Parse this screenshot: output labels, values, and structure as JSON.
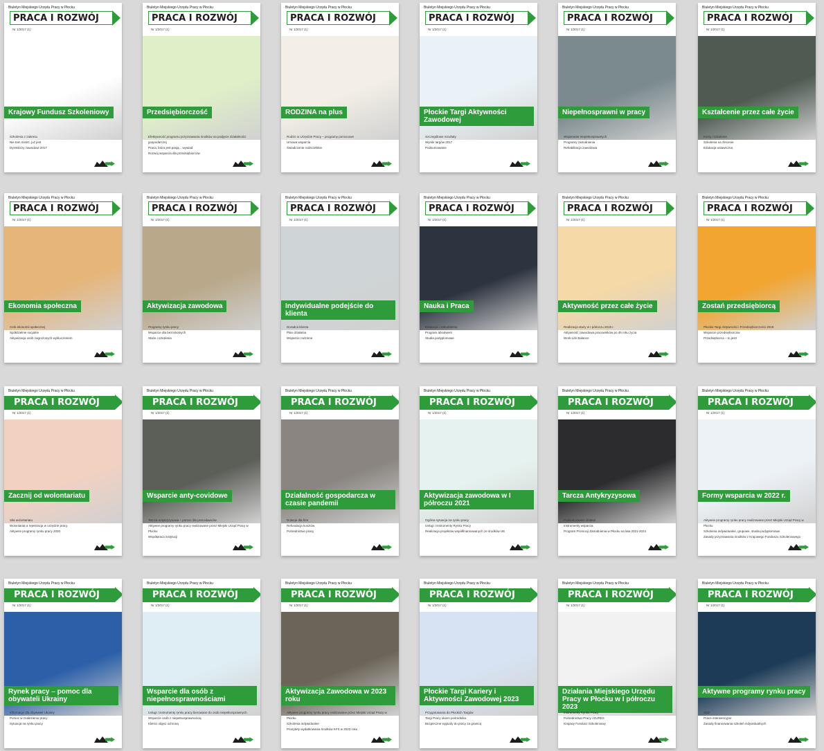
{
  "covers": [
    {
      "title": "Krajowy Fundusz Szkoleniowy",
      "lines": [
        "Szkolenia z zakresu",
        "Nie tam mistrz, już jest",
        "Dyrektorzy zawodowi 2017"
      ],
      "bg": "#ffffff"
    },
    {
      "title": "Przedsiębiorczość",
      "lines": [
        "Efektywność programu przyznawania środków na podjęcie działalności gospodarczej",
        "Praca, która jest pasją... wywiad",
        "Rozwój wsparcia dla przedsiębiorców"
      ],
      "bg": "#dff0c8"
    },
    {
      "title": "RODZINA na plus",
      "lines": [
        "Rodzic w Urzędzie Pracy – programy pomocowe",
        "Umowa wsparcia",
        "Świadczenie rodzicielskie"
      ],
      "bg": "#f3efe6"
    },
    {
      "title": "Płockie Targi Aktywności Zawodowej",
      "lines": [
        "Szczegółowe rezultaty",
        "Wyniki targów 2017",
        "Podsumowanie"
      ],
      "bg": "#eaf2f7"
    },
    {
      "title": "Niepełnosprawni w pracy",
      "lines": [
        "Wspieranie niepełnosprawnych",
        "Programy zatrudnienia",
        "Rehabilitacja zawodowa"
      ],
      "bg": "#7b8a8f"
    },
    {
      "title": "Kształcenie przez całe życie",
      "lines": [
        "Kursy i szkolenia",
        "Szkolenia na zlecenie",
        "Edukacja ustawiczna"
      ],
      "bg": "#4e5a52"
    },
    {
      "title": "Ekonomia społeczna",
      "lines": [
        "Cele ekonomii społecznej",
        "Spółdzielnie socjalne",
        "Aktywizacja osób zagrożonych wykluczeniem"
      ],
      "bg": "#e6b57a"
    },
    {
      "title": "Aktywizacja zawodowa",
      "lines": [
        "Programy rynku pracy",
        "Wsparcie dla bezrobotnych",
        "Staże i szkolenia"
      ],
      "bg": "#b9a88a"
    },
    {
      "title": "Indywidualne podejście do klienta",
      "lines": [
        "Doradca klienta",
        "Plan działania",
        "Wsparcie rodzinne"
      ],
      "bg": "#cfd4d6"
    },
    {
      "title": "Nauka i Praca",
      "lines": [
        "Edukacja i zatrudnienie",
        "Program absolwent",
        "Studia podyplomowe"
      ],
      "bg": "#2d3440"
    },
    {
      "title": "Aktywność przez całe życie",
      "lines": [
        "Realizacja staży w I półroczu 2019 r.",
        "Aktywność zawodowa pracowników po 45 roku życia",
        "Work-Life Balance"
      ],
      "bg": "#f5d9a6"
    },
    {
      "title": "Zostań przedsiębiorcą",
      "lines": [
        "Płockie Targi Aktywności i Przedsiębiorczości 2019",
        "Wsparcie przedsiębiorców",
        "Przedsiębiorca – to jest!"
      ],
      "bg": "#f2a531"
    },
    {
      "title": "Zacznij od wolontariatu",
      "lines": [
        "Siła wolontariatu",
        "Wolontariat a rejestracja w urzędzie pracy",
        "Aktywne programy rynku pracy 2020"
      ],
      "bg": "#f3d1c1"
    },
    {
      "title": "Wsparcie anty-covidowe",
      "lines": [
        "Tarcza Antykryzysowa – pomoc dla pracodawców",
        "Aktywne programy rynku pracy realizowane przez Miejski Urząd Pracy w Płocku",
        "Współpraca instytucji"
      ],
      "bg": "#5c5e58"
    },
    {
      "title": "Działalność gospodarcza w czasie pandemii",
      "lines": [
        "Dotacje dla firm",
        "Refundacja kosztów",
        "Pośrednictwo pracy"
      ],
      "bg": "#8a8580"
    },
    {
      "title": "Aktywizacja zawodowa w I półroczu 2021",
      "lines": [
        "Ogólna sytuacja na rynku pracy",
        "Usługi i instrumenty Rynku Pracy",
        "Realizacja projektów współfinansowanych ze środków UE"
      ],
      "bg": "#e6f2ef"
    },
    {
      "title": "Tarcza Antykryzysowa",
      "lines": [
        "Podsumowanie działań",
        "Instrumenty wsparcia",
        "Program Promocji Zatrudnienia w Płocku na lata 2021-2024"
      ],
      "bg": "#2c2c2e"
    },
    {
      "title": "Formy wsparcia w 2022 r.",
      "lines": [
        "Aktywne programy rynku pracy realizowane przez Miejski Urząd Pracy w Płocku",
        "Szkolenia indywidualne, grupowe, studia podyplomowe",
        "Zasady przyznawania środków z Krajowego Funduszu Szkoleniowego"
      ],
      "bg": "#edf2f7"
    },
    {
      "title": "Rynek pracy – pomoc dla obywateli Ukrainy",
      "lines": [
        "Informacje dla obywateli Ukrainy",
        "Pomoc w znalezieniu pracy",
        "Sytuacja na rynku pracy"
      ],
      "bg": "#2b5fa8"
    },
    {
      "title": "Wsparcie dla osób z niepełnosprawnościami",
      "lines": [
        "Usługi i instrumenty rynku pracy kierowane do osób niepełnosprawnych",
        "Wsparcie osób z niepełnosprawnością",
        "Klienci objęci ochroną"
      ],
      "bg": "#dfeef4"
    },
    {
      "title": "Aktywizacja Zawodowa w 2023 roku",
      "lines": [
        "Aktywne programy rynku pracy realizowane przez Miejski Urząd Pracy w Płocku",
        "Szkolenia indywidualne",
        "Priorytety wydatkowania środków KFS w 2023 roku"
      ],
      "bg": "#6b6458"
    },
    {
      "title": "Płockie Targi Kariery i Aktywności Zawodowej 2023",
      "lines": [
        "Przygotowania do Płockich Targów",
        "Targi Pracy okiem pośrednika",
        "Bezpieczne wyjazdy do pracy za granicą"
      ],
      "bg": "#d7e3f2"
    },
    {
      "title": "Działania Miejskiego Urzędu Pracy w Płocku w I półroczu 2023",
      "lines": [
        "Instrumenty Rynku Pracy",
        "Pośrednictwo Pracy i EURES",
        "Krajowy Fundusz Szkoleniowy"
      ],
      "bg": "#f2f2f2"
    },
    {
      "title": "Aktywne programy rynku pracy",
      "lines": [
        "Staż",
        "Prace interwencyjne",
        "Zasady finansowania szkoleń indywidualnych"
      ],
      "bg": "#1d3b57"
    }
  ],
  "brand": {
    "publisher": "Biuletyn Miejskiego Urzędu Pracy w Płocku",
    "logo_text": "PRACA I ROZWÓJ",
    "issue_text": "Nr 1/2017 (1)",
    "accent": "#2e9c3a"
  }
}
